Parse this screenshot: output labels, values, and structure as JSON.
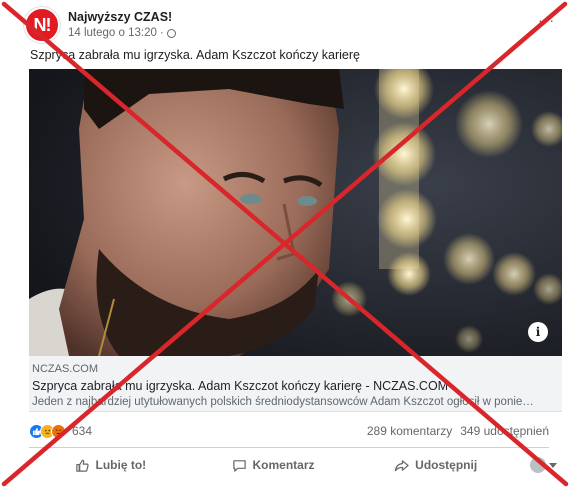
{
  "post": {
    "page_name": "Najwyższy CZAS!",
    "avatar_text": "N!",
    "time": "14 lutego o 13:20",
    "more": "···",
    "caption": "Szpryca zabrała mu igrzyska. Adam Kszczot kończy karierę"
  },
  "link": {
    "domain": "NCZAS.COM",
    "title": "Szpryca zabrała mu igrzyska. Adam Kszczot kończy karierę - NCZAS.COM",
    "description": "Jeden z najbardziej utytułowanych polskich średniodystansowców Adam Kszczot ogłosił w ponie…",
    "info": "i"
  },
  "stats": {
    "reaction_count": "634",
    "comments": "289 komentarzy",
    "shares": "349 udostępnień"
  },
  "actions": {
    "like": "Lubię to!",
    "comment": "Komentarz",
    "share": "Udostępnij"
  },
  "colors": {
    "brand_red": "#e21b22",
    "cross_red": "#d9262b",
    "like_blue": "#1877f2"
  }
}
